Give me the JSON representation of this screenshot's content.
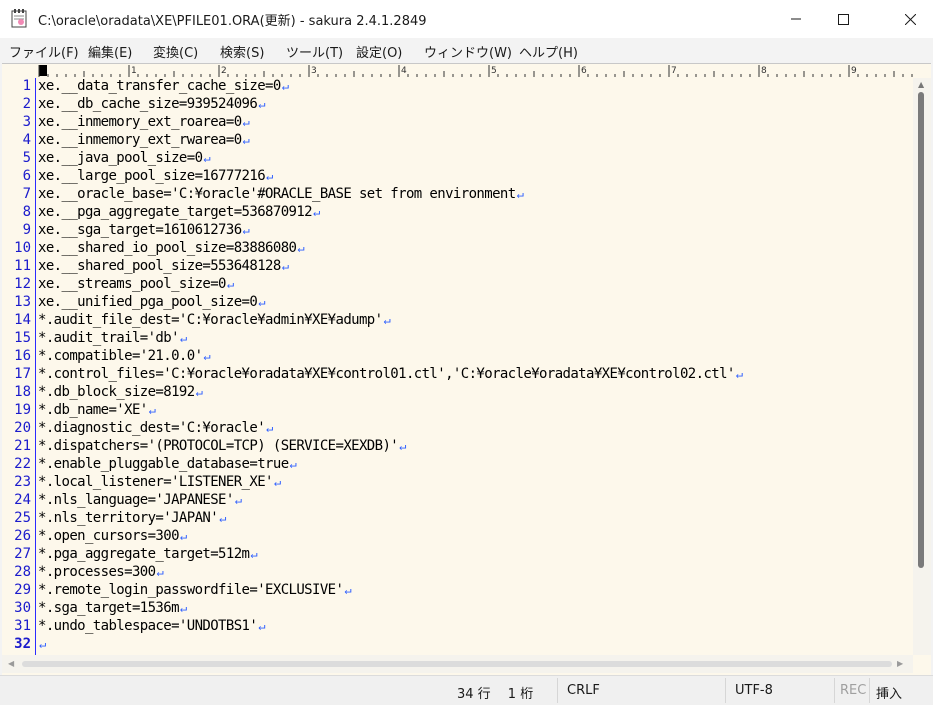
{
  "window": {
    "title": "C:\\oracle\\oradata\\XE\\PFILE01.ORA(更新) - sakura 2.4.1.2849",
    "minimize_glyph": "—",
    "maximize_glyph": "☐",
    "close_glyph": "✕"
  },
  "menu": {
    "items": [
      {
        "label": "ファイル(F)"
      },
      {
        "label": "編集(E)"
      },
      {
        "label": "変換(C)"
      },
      {
        "label": "検索(S)"
      },
      {
        "label": "ツール(T)"
      },
      {
        "label": "設定(O)"
      },
      {
        "label": "ウィンドウ(W)"
      },
      {
        "label": "ヘルプ(H)"
      }
    ]
  },
  "ruler": {
    "marks": [
      "1",
      "2",
      "3",
      "4",
      "5",
      "6",
      "7",
      "8",
      "9"
    ]
  },
  "editor": {
    "eol_glyph": "↵",
    "current_line": 32,
    "lines": [
      "xe.__data_transfer_cache_size=0",
      "xe.__db_cache_size=939524096",
      "xe.__inmemory_ext_roarea=0",
      "xe.__inmemory_ext_rwarea=0",
      "xe.__java_pool_size=0",
      "xe.__large_pool_size=16777216",
      "xe.__oracle_base='C:¥oracle'#ORACLE_BASE set from environment",
      "xe.__pga_aggregate_target=536870912",
      "xe.__sga_target=1610612736",
      "xe.__shared_io_pool_size=83886080",
      "xe.__shared_pool_size=553648128",
      "xe.__streams_pool_size=0",
      "xe.__unified_pga_pool_size=0",
      "*.audit_file_dest='C:¥oracle¥admin¥XE¥adump'",
      "*.audit_trail='db'",
      "*.compatible='21.0.0'",
      "*.control_files='C:¥oracle¥oradata¥XE¥control01.ctl','C:¥oracle¥oradata¥XE¥control02.ctl'",
      "*.db_block_size=8192",
      "*.db_name='XE'",
      "*.diagnostic_dest='C:¥oracle'",
      "*.dispatchers='(PROTOCOL=TCP) (SERVICE=XEXDB)'",
      "*.enable_pluggable_database=true",
      "*.local_listener='LISTENER_XE'",
      "*.nls_language='JAPANESE'",
      "*.nls_territory='JAPAN'",
      "*.open_cursors=300",
      "*.pga_aggregate_target=512m",
      "*.processes=300",
      "*.remote_login_passwordfile='EXCLUSIVE'",
      "*.sga_target=1536m",
      "*.undo_tablespace='UNDOTBS1'",
      ""
    ]
  },
  "statusbar": {
    "position": "34 行　 1 桁",
    "line_ending": "CRLF",
    "encoding": "UTF-8",
    "rec": "REC",
    "mode": "挿入"
  },
  "colors": {
    "editor_bg": "#fdf8eb",
    "line_number": "#1b1bcc",
    "eol_mark": "#2e5fff"
  }
}
